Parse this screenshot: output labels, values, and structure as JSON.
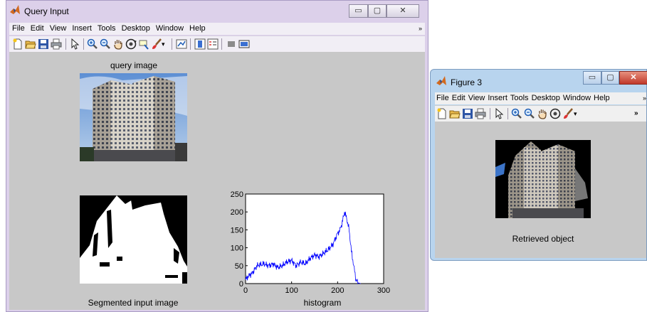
{
  "window_main": {
    "title": "Query Input",
    "menu": [
      "File",
      "Edit",
      "View",
      "Insert",
      "Tools",
      "Desktop",
      "Window",
      "Help"
    ],
    "menu_more": "»",
    "controls": {
      "minimize": "▭",
      "maximize": "▢",
      "close": "✕"
    },
    "query_image_label": "query image",
    "segmented_label": "Segmented input image",
    "histogram_label": "histogram"
  },
  "window_figure": {
    "title": "Figure 3",
    "menu": [
      "File",
      "Edit",
      "View",
      "Insert",
      "Tools",
      "Desktop",
      "Window",
      "Help"
    ],
    "menu_more": "»",
    "toolbar_more": "»",
    "controls": {
      "minimize": "▭",
      "maximize": "▢",
      "close": "✕"
    },
    "retrieved_label": "Retrieved object"
  },
  "chart_data": {
    "type": "line",
    "title": "",
    "xlabel": "histogram",
    "ylabel": "",
    "xlim": [
      0,
      300
    ],
    "ylim": [
      0,
      250
    ],
    "xticks": [
      0,
      100,
      200,
      300
    ],
    "yticks": [
      0,
      50,
      100,
      150,
      200,
      250
    ],
    "grid": false,
    "series": [
      {
        "color": "#0000ff",
        "x": [
          0,
          5,
          10,
          15,
          20,
          25,
          30,
          40,
          50,
          60,
          70,
          80,
          90,
          100,
          110,
          120,
          130,
          140,
          150,
          160,
          170,
          180,
          190,
          200,
          205,
          210,
          215,
          220,
          225,
          230,
          235,
          240,
          245,
          250
        ],
        "y": [
          10,
          20,
          25,
          30,
          40,
          50,
          52,
          55,
          50,
          55,
          45,
          50,
          60,
          65,
          50,
          60,
          55,
          70,
          80,
          75,
          85,
          95,
          110,
          140,
          150,
          170,
          200,
          180,
          150,
          90,
          50,
          10,
          2,
          0
        ]
      }
    ]
  }
}
